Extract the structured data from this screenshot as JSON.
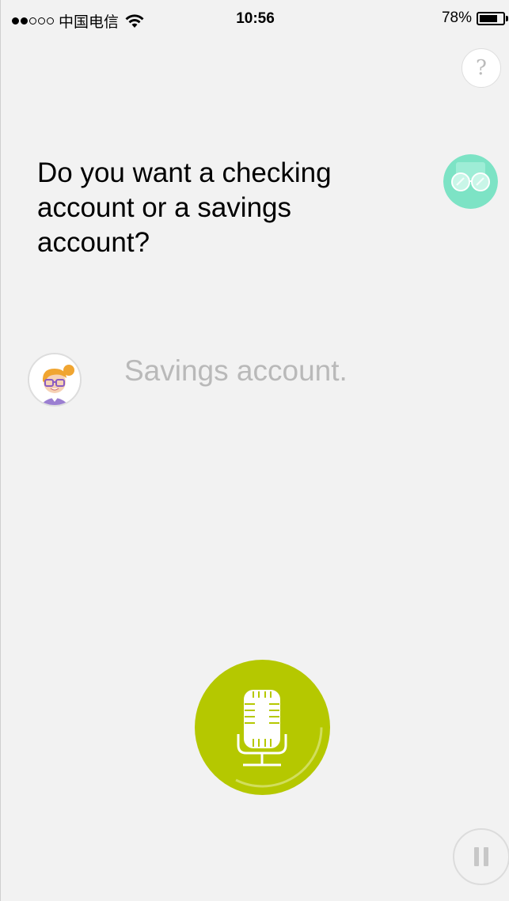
{
  "status_bar": {
    "carrier": "中国电信",
    "time": "10:56",
    "battery_percent": "78%",
    "battery_level": 0.78,
    "signal_strength": 2,
    "signal_total": 5
  },
  "help": {
    "icon": "question-mark-icon",
    "label": "?"
  },
  "conversation": {
    "assistant_message": "Do you want a checking account or a savings account?",
    "user_reply": "Savings account."
  },
  "mic": {
    "icon": "microphone-icon",
    "color": "#b5c800"
  },
  "pause": {
    "icon": "pause-icon"
  },
  "colors": {
    "background": "#f2f2f2",
    "accent_green": "#b5c800",
    "assistant_teal": "#7de3c5",
    "reply_text": "#b9b9b9"
  }
}
